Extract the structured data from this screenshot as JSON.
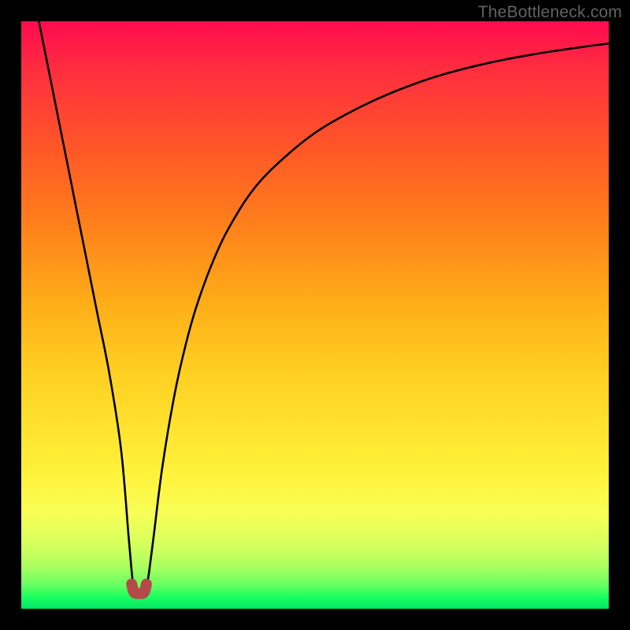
{
  "watermark": "TheBottleneck.com",
  "chart_data": {
    "type": "line",
    "title": "",
    "xlabel": "",
    "ylabel": "",
    "xlim": [
      0,
      100
    ],
    "ylim": [
      0,
      100
    ],
    "grid": false,
    "series": [
      {
        "name": "main-curve",
        "x": [
          3,
          5,
          7,
          9,
          11,
          13,
          15,
          17,
          18.3,
          19,
          19.5,
          20.2,
          21,
          21.5,
          22.5,
          24,
          26,
          28,
          30,
          33,
          36,
          40,
          45,
          50,
          55,
          60,
          66,
          72,
          80,
          88,
          96,
          100
        ],
        "y": [
          100,
          90,
          80,
          70,
          60,
          50,
          40,
          27,
          12,
          4.5,
          2.7,
          2.6,
          2.7,
          4.5,
          12,
          24,
          36,
          45,
          52,
          60,
          66,
          72,
          77,
          81,
          84,
          86.5,
          89,
          91,
          93,
          94.5,
          95.7,
          96.2
        ]
      },
      {
        "name": "bottom-marker",
        "x": [
          18.8,
          19.2,
          20.0,
          20.9,
          21.3
        ],
        "y": [
          4.2,
          2.8,
          2.6,
          2.8,
          4.2
        ]
      }
    ],
    "colors": {
      "main_curve": "#000000",
      "bottom_marker": "#b34a49",
      "gradient_top": "#ff0a4f",
      "gradient_bottom": "#00e566"
    }
  }
}
